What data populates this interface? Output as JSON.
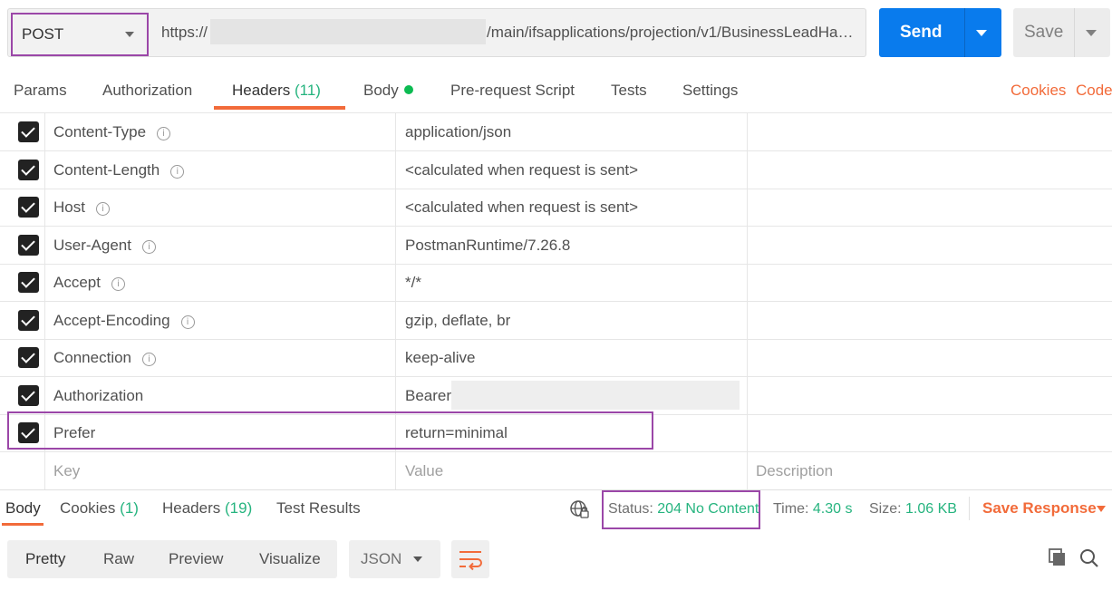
{
  "request": {
    "method": "POST",
    "url_prefix": "https://",
    "url_suffix": "/main/ifsapplications/projection/v1/BusinessLeadHa…",
    "send_label": "Send",
    "save_label": "Save"
  },
  "tabs": [
    {
      "label": "Params"
    },
    {
      "label": "Authorization"
    },
    {
      "label": "Headers",
      "count": "(11)"
    },
    {
      "label": "Body"
    },
    {
      "label": "Pre-request Script"
    },
    {
      "label": "Tests"
    },
    {
      "label": "Settings"
    }
  ],
  "links": {
    "cookies": "Cookies",
    "code": "Code"
  },
  "headers": [
    {
      "key": "Content-Type",
      "value": "application/json"
    },
    {
      "key": "Content-Length",
      "value": "<calculated when request is sent>"
    },
    {
      "key": "Host",
      "value": "<calculated when request is sent>"
    },
    {
      "key": "User-Agent",
      "value": "PostmanRuntime/7.26.8"
    },
    {
      "key": "Accept",
      "value": "*/*"
    },
    {
      "key": "Accept-Encoding",
      "value": "gzip, deflate, br"
    },
    {
      "key": "Connection",
      "value": "keep-alive"
    },
    {
      "key": "Authorization",
      "value": "Bearer"
    },
    {
      "key": "Prefer",
      "value": "return=minimal"
    }
  ],
  "new_row": {
    "key": "Key",
    "value": "Value",
    "description": "Description"
  },
  "response": {
    "tabs": [
      {
        "label": "Body"
      },
      {
        "label": "Cookies",
        "count": "(1)"
      },
      {
        "label": "Headers",
        "count": "(19)"
      },
      {
        "label": "Test Results"
      }
    ],
    "status_label": "Status:",
    "status_value": "204 No Content",
    "time_label": "Time:",
    "time_value": "4.30 s",
    "size_label": "Size:",
    "size_value": "1.06 KB",
    "save_response": "Save Response"
  },
  "view": {
    "modes": [
      "Pretty",
      "Raw",
      "Preview",
      "Visualize"
    ],
    "language": "JSON"
  },
  "colors": {
    "accent": "#f26b3a",
    "send": "#097bed",
    "success": "#26b47f",
    "highlight": "#9b47a8"
  }
}
